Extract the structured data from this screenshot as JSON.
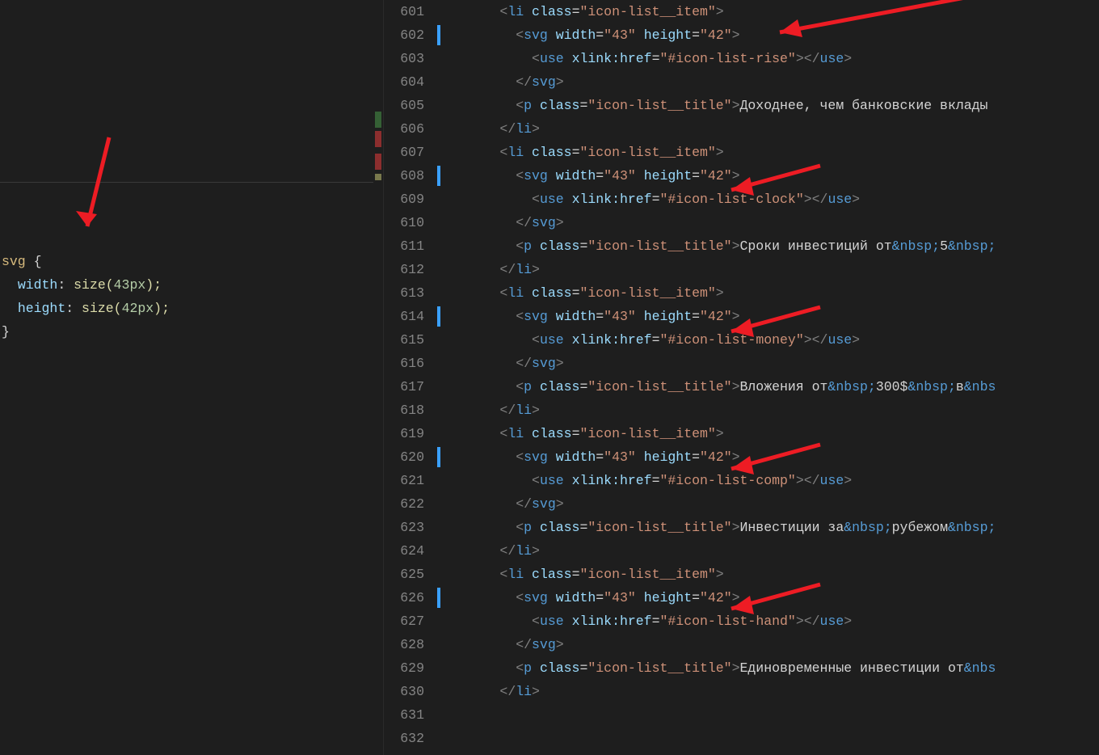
{
  "left_pane": {
    "css_rule": {
      "selector": "svg",
      "open_brace": " {",
      "close_brace": "}",
      "decl1_prop": "width",
      "decl1_colon": ": ",
      "decl1_func": "size",
      "decl1_open": "(",
      "decl1_val": "43px",
      "decl1_close": ");",
      "decl2_prop": "height",
      "decl2_colon": ": ",
      "decl2_func": "size",
      "decl2_open": "(",
      "decl2_val": "42px",
      "decl2_close": ");"
    }
  },
  "right_pane": {
    "line_start": 601,
    "lines": [
      {
        "n": "601",
        "indent": "      ",
        "tag_open": "<",
        "tag": "li",
        "sp": " ",
        "attr": "class",
        "eq": "=",
        "q": "\"",
        "val": "icon-list__item",
        "q2": "\"",
        "close": ">"
      },
      {
        "n": "602",
        "mod": true,
        "indent": "        ",
        "tag_open": "<",
        "tag": "svg",
        "sp": " ",
        "a1": "width",
        "eq1": "=",
        "q1": "\"",
        "v1": "43",
        "q1b": "\"",
        "sp2": " ",
        "a2": "height",
        "eq2": "=",
        "q2": "\"",
        "v2": "42",
        "q2b": "\"",
        "close": ">"
      },
      {
        "n": "603",
        "indent": "          ",
        "tag_open": "<",
        "tag": "use",
        "sp": " ",
        "attr": "xlink:href",
        "eq": "=",
        "q": "\"",
        "val": "#icon-list-rise",
        "q2": "\"",
        "close": ">",
        "close_tag": "</",
        "ctag": "use",
        "cclose": ">"
      },
      {
        "n": "604",
        "indent": "        ",
        "close_tag": "</",
        "ctag": "svg",
        "cclose": ">"
      },
      {
        "n": "605",
        "indent": "        ",
        "tag_open": "<",
        "tag": "p",
        "sp": " ",
        "attr": "class",
        "eq": "=",
        "q": "\"",
        "val": "icon-list__title",
        "q2": "\"",
        "close": ">",
        "text": "Доходнее, чем банковские вклады"
      },
      {
        "n": "606",
        "indent": "      ",
        "close_tag": "</",
        "ctag": "li",
        "cclose": ">"
      },
      {
        "n": "607",
        "indent": "      ",
        "tag_open": "<",
        "tag": "li",
        "sp": " ",
        "attr": "class",
        "eq": "=",
        "q": "\"",
        "val": "icon-list__item",
        "q2": "\"",
        "close": ">"
      },
      {
        "n": "608",
        "mod": true,
        "indent": "        ",
        "tag_open": "<",
        "tag": "svg",
        "sp": " ",
        "a1": "width",
        "eq1": "=",
        "q1": "\"",
        "v1": "43",
        "q1b": "\"",
        "sp2": " ",
        "a2": "height",
        "eq2": "=",
        "q2": "\"",
        "v2": "42",
        "q2b": "\"",
        "close": ">"
      },
      {
        "n": "609",
        "indent": "          ",
        "tag_open": "<",
        "tag": "use",
        "sp": " ",
        "attr": "xlink:href",
        "eq": "=",
        "q": "\"",
        "val": "#icon-list-clock",
        "q2": "\"",
        "close": ">",
        "close_tag": "</",
        "ctag": "use",
        "cclose": ">"
      },
      {
        "n": "610",
        "indent": "        ",
        "close_tag": "</",
        "ctag": "svg",
        "cclose": ">"
      },
      {
        "n": "611",
        "indent": "        ",
        "tag_open": "<",
        "tag": "p",
        "sp": " ",
        "attr": "class",
        "eq": "=",
        "q": "\"",
        "val": "icon-list__title",
        "q2": "\"",
        "close": ">",
        "text": "Сроки инвестиций от",
        "ent1": "&nbsp;",
        "text2": "5",
        "ent2": "&nbsp;"
      },
      {
        "n": "612",
        "indent": "      ",
        "close_tag": "</",
        "ctag": "li",
        "cclose": ">"
      },
      {
        "n": "613",
        "indent": "      ",
        "tag_open": "<",
        "tag": "li",
        "sp": " ",
        "attr": "class",
        "eq": "=",
        "q": "\"",
        "val": "icon-list__item",
        "q2": "\"",
        "close": ">"
      },
      {
        "n": "614",
        "mod": true,
        "indent": "        ",
        "tag_open": "<",
        "tag": "svg",
        "sp": " ",
        "a1": "width",
        "eq1": "=",
        "q1": "\"",
        "v1": "43",
        "q1b": "\"",
        "sp2": " ",
        "a2": "height",
        "eq2": "=",
        "q2": "\"",
        "v2": "42",
        "q2b": "\"",
        "close": ">"
      },
      {
        "n": "615",
        "indent": "          ",
        "tag_open": "<",
        "tag": "use",
        "sp": " ",
        "attr": "xlink:href",
        "eq": "=",
        "q": "\"",
        "val": "#icon-list-money",
        "q2": "\"",
        "close": ">",
        "close_tag": "</",
        "ctag": "use",
        "cclose": ">"
      },
      {
        "n": "616",
        "indent": "        ",
        "close_tag": "</",
        "ctag": "svg",
        "cclose": ">"
      },
      {
        "n": "617",
        "indent": "        ",
        "tag_open": "<",
        "tag": "p",
        "sp": " ",
        "attr": "class",
        "eq": "=",
        "q": "\"",
        "val": "icon-list__title",
        "q2": "\"",
        "close": ">",
        "text": "Вложения от",
        "ent1": "&nbsp;",
        "text2": "300$",
        "ent2": "&nbsp;",
        "text3": "в",
        "ent3": "&nbs"
      },
      {
        "n": "618",
        "indent": "      ",
        "close_tag": "</",
        "ctag": "li",
        "cclose": ">"
      },
      {
        "n": "619",
        "indent": "      ",
        "tag_open": "<",
        "tag": "li",
        "sp": " ",
        "attr": "class",
        "eq": "=",
        "q": "\"",
        "val": "icon-list__item",
        "q2": "\"",
        "close": ">"
      },
      {
        "n": "620",
        "mod": true,
        "indent": "        ",
        "tag_open": "<",
        "tag": "svg",
        "sp": " ",
        "a1": "width",
        "eq1": "=",
        "q1": "\"",
        "v1": "43",
        "q1b": "\"",
        "sp2": " ",
        "a2": "height",
        "eq2": "=",
        "q2": "\"",
        "v2": "42",
        "q2b": "\"",
        "close": ">"
      },
      {
        "n": "621",
        "indent": "          ",
        "tag_open": "<",
        "tag": "use",
        "sp": " ",
        "attr": "xlink:href",
        "eq": "=",
        "q": "\"",
        "val": "#icon-list-comp",
        "q2": "\"",
        "close": ">",
        "close_tag": "</",
        "ctag": "use",
        "cclose": ">"
      },
      {
        "n": "622",
        "indent": "        ",
        "close_tag": "</",
        "ctag": "svg",
        "cclose": ">"
      },
      {
        "n": "623",
        "indent": "        ",
        "tag_open": "<",
        "tag": "p",
        "sp": " ",
        "attr": "class",
        "eq": "=",
        "q": "\"",
        "val": "icon-list__title",
        "q2": "\"",
        "close": ">",
        "text": "Инвестиции за",
        "ent1": "&nbsp;",
        "text2": "рубежом",
        "ent2": "&nbsp;"
      },
      {
        "n": "624",
        "indent": "      ",
        "close_tag": "</",
        "ctag": "li",
        "cclose": ">"
      },
      {
        "n": "625",
        "indent": "      ",
        "tag_open": "<",
        "tag": "li",
        "sp": " ",
        "attr": "class",
        "eq": "=",
        "q": "\"",
        "val": "icon-list__item",
        "q2": "\"",
        "close": ">"
      },
      {
        "n": "626",
        "mod": true,
        "indent": "        ",
        "tag_open": "<",
        "tag": "svg",
        "sp": " ",
        "a1": "width",
        "eq1": "=",
        "q1": "\"",
        "v1": "43",
        "q1b": "\"",
        "sp2": " ",
        "a2": "height",
        "eq2": "=",
        "q2": "\"",
        "v2": "42",
        "q2b": "\"",
        "close": ">"
      },
      {
        "n": "627",
        "indent": "          ",
        "tag_open": "<",
        "tag": "use",
        "sp": " ",
        "attr": "xlink:href",
        "eq": "=",
        "q": "\"",
        "val": "#icon-list-hand",
        "q2": "\"",
        "close": ">",
        "close_tag": "</",
        "ctag": "use",
        "cclose": ">"
      },
      {
        "n": "628",
        "indent": "        ",
        "close_tag": "</",
        "ctag": "svg",
        "cclose": ">"
      },
      {
        "n": "629",
        "indent": "        ",
        "tag_open": "<",
        "tag": "p",
        "sp": " ",
        "attr": "class",
        "eq": "=",
        "q": "\"",
        "val": "icon-list__title",
        "q2": "\"",
        "close": ">",
        "text": "Единовременные инвестиции от",
        "ent1": "&nbs"
      },
      {
        "n": "630",
        "indent": "      ",
        "close_tag": "</",
        "ctag": "li",
        "cclose": ">"
      },
      {
        "n": "631",
        "indent": ""
      },
      {
        "n": "632",
        "indent": ""
      }
    ]
  }
}
